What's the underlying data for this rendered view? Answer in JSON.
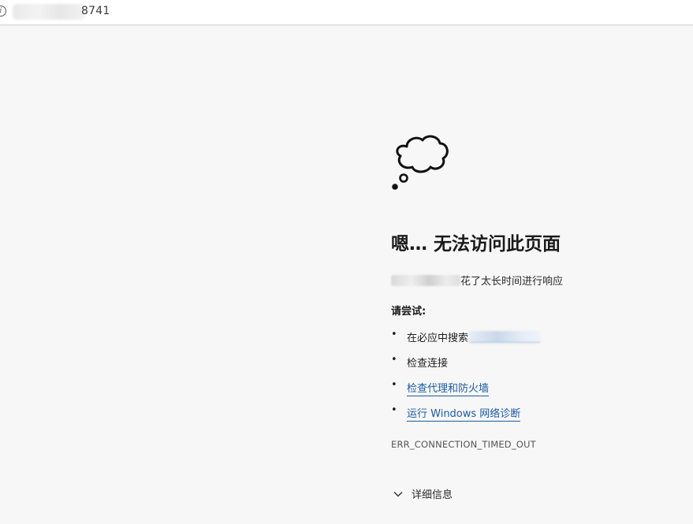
{
  "address_bar": {
    "url_visible_suffix": "8741",
    "info_icon": "info-icon"
  },
  "error_page": {
    "icon": "thought-cloud-icon",
    "title": "嗯… 无法访问此页面",
    "subtitle_suffix": "花了太长时间进行响应",
    "try_label": "请尝试:",
    "suggestions": [
      {
        "prefix": "在必应中搜索",
        "is_link": false
      },
      {
        "label": "检查连接",
        "is_link": false
      },
      {
        "label": "检查代理和防火墙",
        "is_link": true
      },
      {
        "label": "运行 Windows 网络诊断",
        "is_link": true
      }
    ],
    "bullet": "•",
    "error_code": "ERR_CONNECTION_TIMED_OUT",
    "details_label": "详细信息"
  }
}
